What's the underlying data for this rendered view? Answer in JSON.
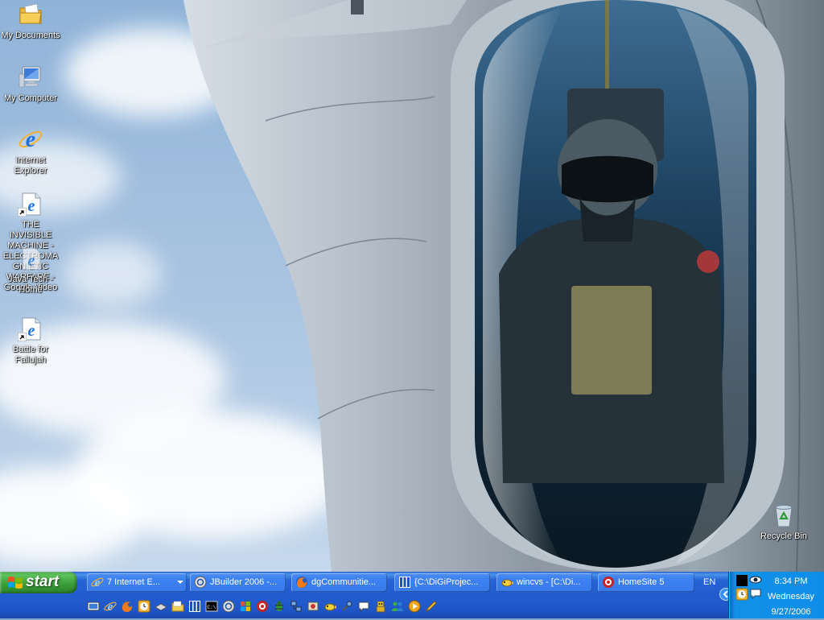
{
  "desktop": {
    "icons": [
      {
        "label": "My Documents",
        "icon": "my-documents-folder-icon"
      },
      {
        "label": "My Computer",
        "icon": "my-computer-icon"
      },
      {
        "label": "Internet Explorer",
        "icon": "internet-explorer-icon"
      },
      {
        "label": "THE INVISIBLE MACHINE - ELECTROMAGN ETIC WARFARE - Google Video",
        "icon": "internet-shortcut-icon"
      },
      {
        "label": "Java Tech - Home",
        "icon": "internet-shortcut-icon"
      },
      {
        "label": "Battle for Fallujah",
        "icon": "internet-shortcut-icon"
      },
      {
        "label": "Recycle Bin",
        "icon": "recycle-bin-icon"
      }
    ]
  },
  "taskbar": {
    "start_label": "start",
    "tasks": [
      {
        "label": "7 Internet E...",
        "icon": "internet-explorer-icon"
      },
      {
        "label": "JBuilder 2006 -...",
        "icon": "jbuilder-icon"
      },
      {
        "label": "dgCommunitie...",
        "icon": "firefox-icon"
      },
      {
        "label": "{C:\\DiGiProjec...",
        "icon": "project-grid-icon"
      },
      {
        "label": "wincvs - [C:\\Di...",
        "icon": "wincvs-icon"
      },
      {
        "label": "HomeSite 5",
        "icon": "homesite-icon"
      }
    ],
    "quick_launch": [
      "show-desktop-icon",
      "internet-explorer-icon",
      "firefox-icon",
      "clock-icon",
      "scanner-icon",
      "folder-icon",
      "project-grid-icon",
      "command-prompt-icon",
      "jbuilder-icon",
      "windows-flag-icon",
      "homesite-icon",
      "bug-icon",
      "network-icon",
      "settings-icon",
      "wincvs-icon",
      "tool-icon",
      "chat-icon",
      "robot-icon",
      "people-icon",
      "media-player-icon",
      "pencil-icon"
    ]
  },
  "tray": {
    "language": "EN",
    "time": "8:34 PM",
    "day": "Wednesday",
    "date": "9/27/2006",
    "icons": [
      "black-square-icon",
      "eye-icon",
      "show-hidden-icons-chevron-icon",
      "clock-tray-icon",
      "speech-bubble-icon"
    ]
  }
}
